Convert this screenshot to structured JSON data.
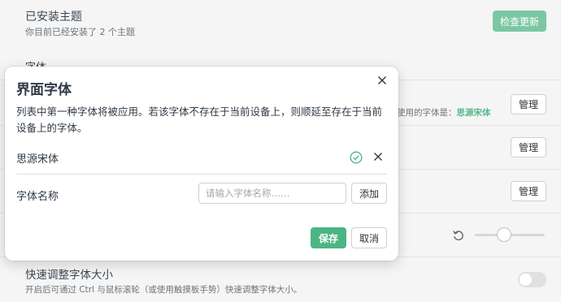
{
  "background": {
    "themes": {
      "title": "已安装主题",
      "description": "你目前已经安装了 2 个主题",
      "check_update_label": "检查更新"
    },
    "font_section_heading": "字体",
    "interface_font": {
      "used_prefix": "使用的字体是：",
      "used_value": "思源宋体",
      "manage_label": "管理"
    },
    "row2": {
      "manage_label": "管理"
    },
    "row3": {
      "manage_label": "管理"
    },
    "quick_font_size": {
      "title": "快速调整字体大小",
      "description": "开启后可通过 Ctrl 与鼠标滚轮（或使用触摸板手势）快速调整字体大小。",
      "enabled": false
    },
    "slider": {
      "value": 0.4
    }
  },
  "modal": {
    "title": "界面字体",
    "description": "列表中第一种字体将被应用。若该字体不存在于当前设备上，则顺延至存在于当前设备上的字体。",
    "font_list": [
      {
        "name": "思源宋体",
        "available": true
      }
    ],
    "input": {
      "label": "字体名称",
      "placeholder": "请输入字体名称……",
      "value": ""
    },
    "add_label": "添加",
    "save_label": "保存",
    "cancel_label": "取消"
  },
  "colors": {
    "accent": "#4bb583",
    "accent_light": "#7bc7a3",
    "background": "#f5f5f5"
  },
  "icons": {
    "close": "close-icon",
    "check": "check-circle-icon",
    "remove": "remove-icon",
    "reset": "reset-icon"
  }
}
